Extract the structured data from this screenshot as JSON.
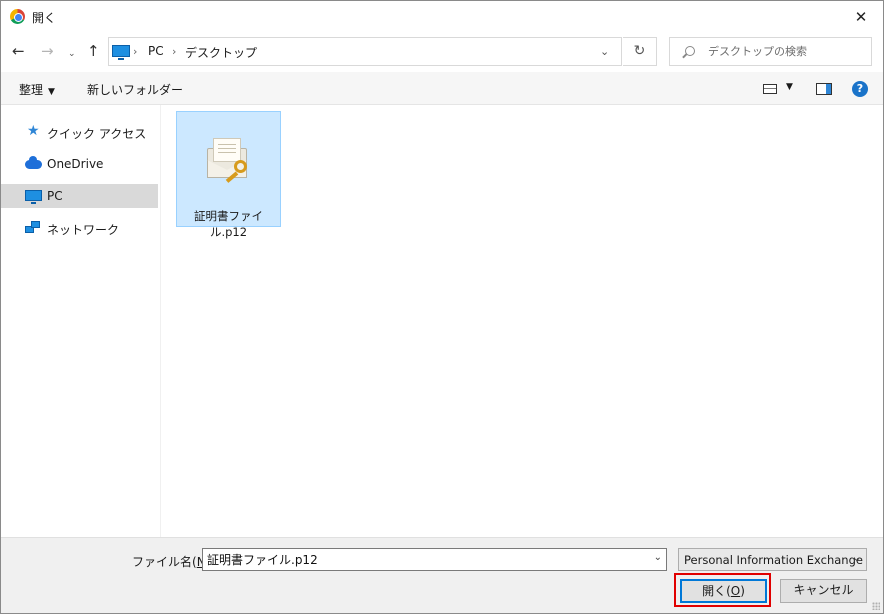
{
  "window": {
    "title": "開く",
    "close_glyph": "✕"
  },
  "nav": {
    "back_glyph": "←",
    "forward_glyph": "→",
    "recent_glyph": "⌄",
    "up_glyph": "↑",
    "separator": "›",
    "breadcrumbs": [
      "PC",
      "デスクトップ"
    ],
    "dropdown_glyph": "⌄",
    "refresh_glyph": "↻",
    "search_placeholder": "デスクトップの検索"
  },
  "toolbar": {
    "organize_label": "整理",
    "organize_caret": "▼",
    "new_folder_label": "新しいフォルダー",
    "view_caret": "▼",
    "help_glyph": "?"
  },
  "sidebar": {
    "items": [
      {
        "label": "クイック アクセス",
        "icon": "star-icon"
      },
      {
        "label": "OneDrive",
        "icon": "cloud-icon"
      },
      {
        "label": "PC",
        "icon": "computer-icon",
        "selected": true
      },
      {
        "label": "ネットワーク",
        "icon": "network-icon"
      }
    ]
  },
  "files": [
    {
      "name": "証明書ファイル.p12",
      "icon": "certificate-file-icon",
      "selected": true
    }
  ],
  "footer": {
    "filename_label_prefix": "ファイル名(",
    "filename_label_key": "N",
    "filename_label_suffix": "):",
    "filename_value": "証明書ファイル.p12",
    "filetype_value": "Personal Information Exchange",
    "caret_glyph": "⌄",
    "open_label_prefix": "開く(",
    "open_label_key": "O",
    "open_label_suffix": ")",
    "cancel_label": "キャンセル"
  },
  "colors": {
    "selection_fill": "#cce8ff",
    "selection_border": "#99d1ff",
    "highlight_outline": "#e00000",
    "default_button_border": "#0078d7"
  }
}
